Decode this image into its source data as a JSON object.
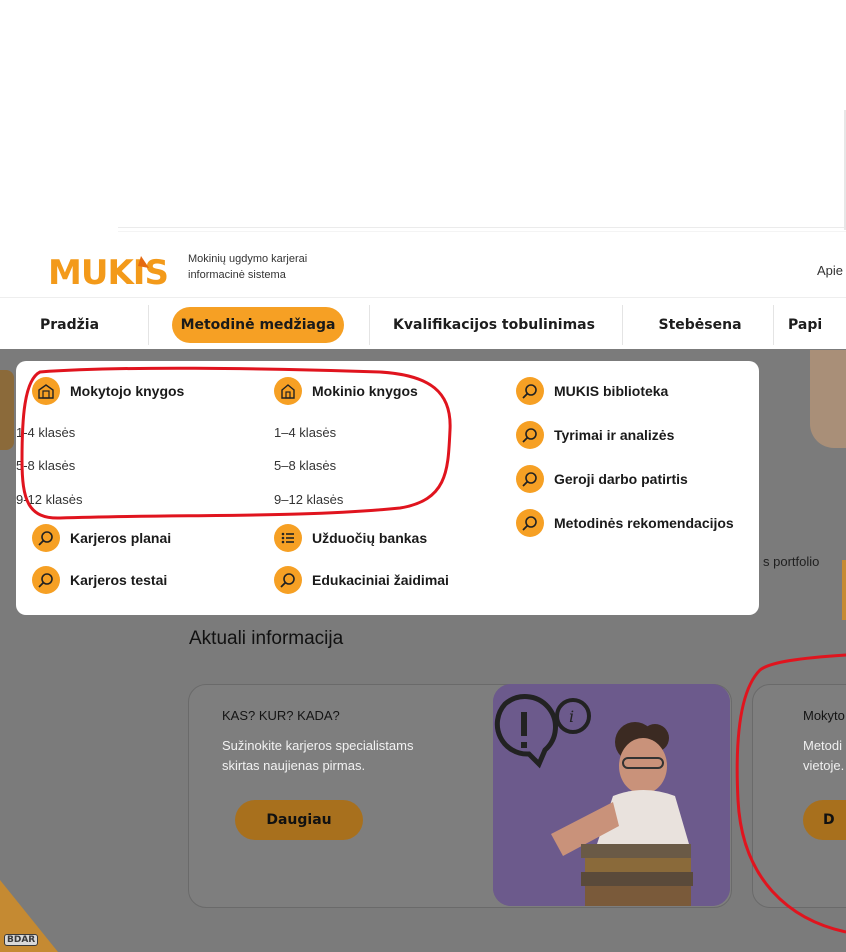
{
  "header": {
    "tagline_line1": "Mokinių ugdymo karjerai",
    "tagline_line2": "informacinė sistema",
    "right_link": "Apie"
  },
  "nav": {
    "items": [
      {
        "label": "Pradžia"
      },
      {
        "label": "Metodinė medžiaga"
      },
      {
        "label": "Kvalifikacijos tobulinimas"
      },
      {
        "label": "Stebėsena"
      },
      {
        "label": "Papi"
      }
    ]
  },
  "dropdown": {
    "col1": {
      "heading": "Mokytojo knygos",
      "sub": [
        "1-4 klasės",
        "5-8 klasės",
        "9-12 klasės"
      ],
      "items": [
        "Karjeros planai",
        "Karjeros testai"
      ]
    },
    "col2": {
      "heading": "Mokinio knygos",
      "sub": [
        "1–4 klasės",
        "5–8 klasės",
        "9–12 klasės"
      ],
      "items": [
        "Užduočių bankas",
        "Edukaciniai žaidimai"
      ]
    },
    "col3": {
      "items": [
        "MUKIS biblioteka",
        "Tyrimai ir analizės",
        "Geroji darbo patirtis",
        "Metodinės rekomendacijos"
      ]
    }
  },
  "background": {
    "portfolio_text": "s portfolio",
    "section_title": "Aktuali informacija",
    "card1": {
      "heading": "KAS? KUR? KADA?",
      "text_line1": "Sužinokite karjeros specialistams",
      "text_line2": "skirtas naujienas pirmas.",
      "button": "Daugiau"
    },
    "card2": {
      "heading": "Mokyto",
      "text_line1": "Metodi",
      "text_line2": "vietoje.",
      "button": "D"
    },
    "corner_badge": "BDAR"
  },
  "colors": {
    "accent": "#f6a024",
    "annotation_red": "#e0141e",
    "overlay_grey": "#7b7b7b"
  }
}
